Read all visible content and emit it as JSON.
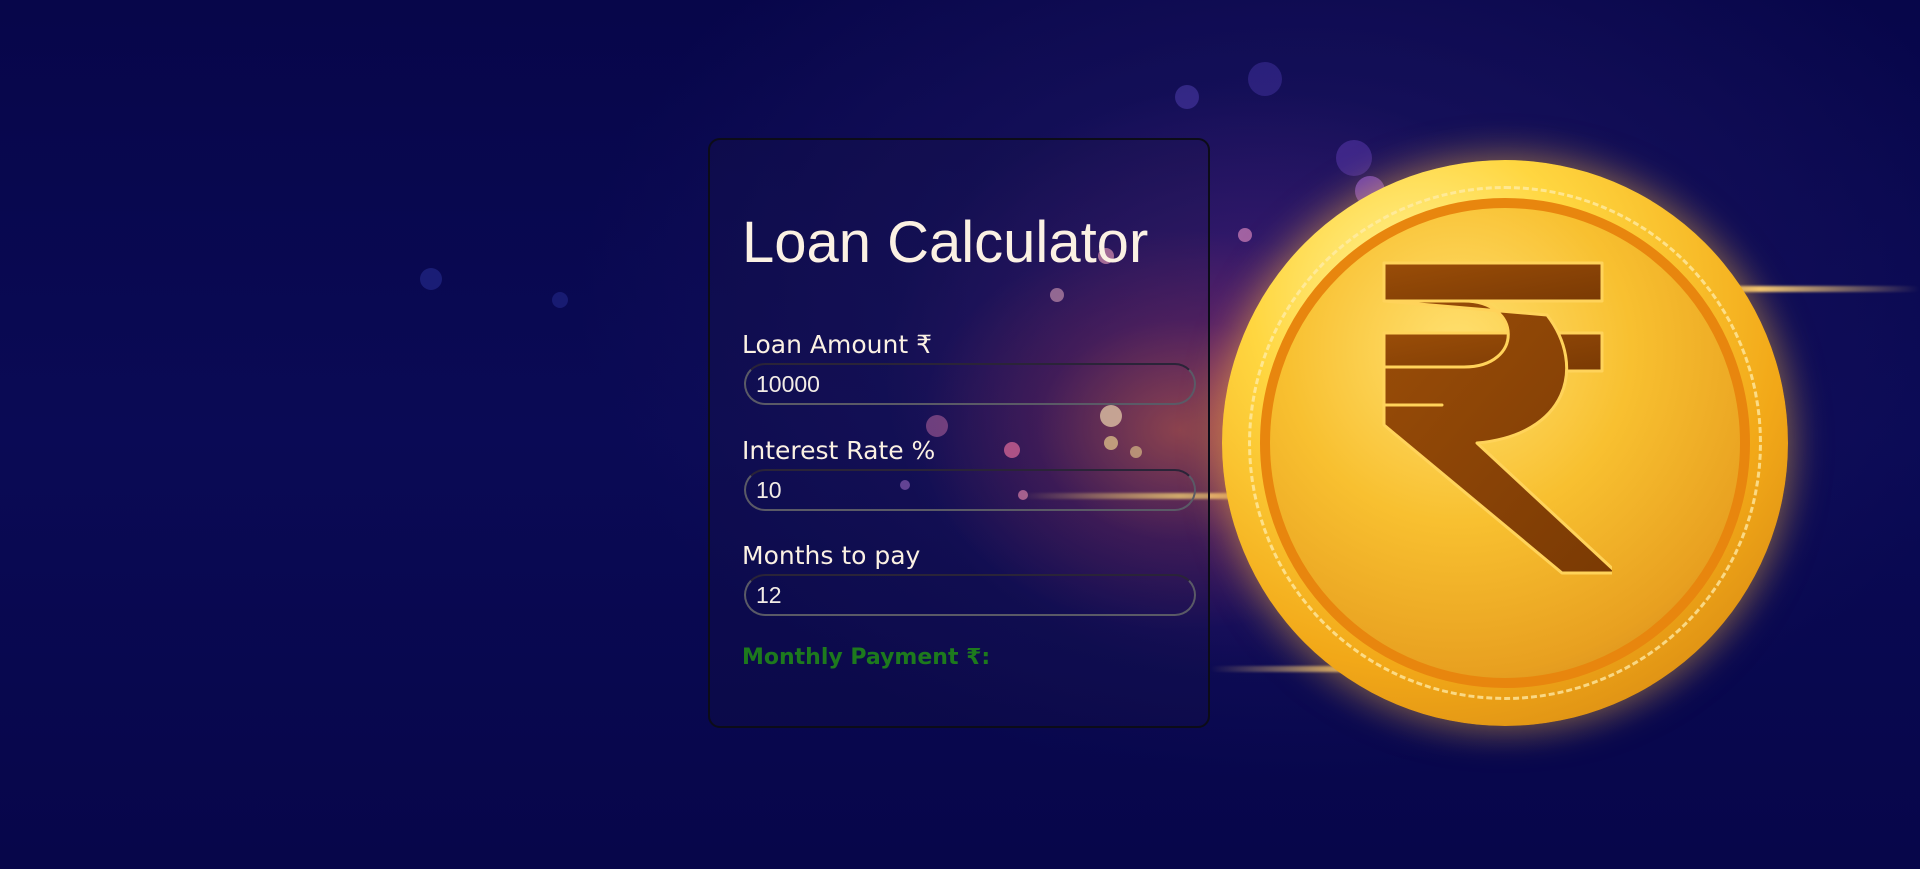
{
  "calculator": {
    "title": "Loan Calculator",
    "fields": [
      {
        "label": "Loan Amount ₹",
        "value": "10000"
      },
      {
        "label": "Interest Rate %",
        "value": "10"
      },
      {
        "label": "Months to pay",
        "value": "12"
      }
    ],
    "result_label": "Monthly Payment ₹:"
  },
  "decor": {
    "coin_icon": "rupee-coin-icon",
    "result_color": "#1d7a1d",
    "text_color": "#fbf1e3"
  }
}
